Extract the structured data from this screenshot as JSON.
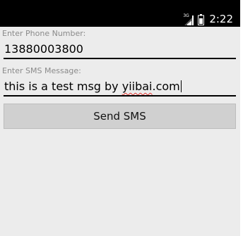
{
  "status_bar": {
    "network_type": "3G",
    "time": "2:22",
    "icons": [
      "signal-3g-icon",
      "battery-icon"
    ]
  },
  "form": {
    "phone_label": "Enter Phone Number:",
    "phone_value": "13880003800",
    "sms_label": "Enter SMS Message:",
    "sms_value_before": "this is a test msg by ",
    "sms_value_misspelled": "yiibai",
    "sms_value_after": ".com",
    "send_button_label": "Send SMS"
  },
  "colors": {
    "status_bar_bg": "#000000",
    "screen_bg": "#ececec",
    "label_text": "#8a8a8a",
    "button_bg": "#d0d0d0",
    "spellcheck_underline": "#e53935"
  }
}
